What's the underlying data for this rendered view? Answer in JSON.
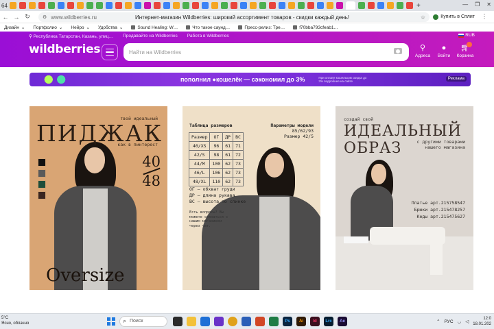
{
  "browser": {
    "tab_label": "64",
    "window_controls": [
      "—",
      "❐",
      "✕"
    ],
    "page_title": "Интернет-магазин Wildberries: широкий ассортимент товаров - скидки каждый день!",
    "url": "www.wildberries.ru",
    "buy_extension": "Купить в Сплит",
    "bookmarks": [
      {
        "label": "Дизайн",
        "icon": "folder-icon"
      },
      {
        "label": "Портфолио",
        "icon": "folder-icon"
      },
      {
        "label": "Нейро",
        "icon": "folder-icon"
      },
      {
        "label": "Удобства",
        "icon": "folder-icon"
      },
      {
        "label": "Sound Healing: W…",
        "icon": "page-icon"
      },
      {
        "label": "Что такое саунд…",
        "icon": "page-icon"
      },
      {
        "label": "Пресс-релиз: Тре…",
        "icon": "page-icon"
      },
      {
        "label": "f70bba793cfeab1…",
        "icon": "page-icon"
      }
    ]
  },
  "header": {
    "location": "Республика Татарстан, Казань, улиц…",
    "sell_link": "Продавайте на Wildberries",
    "work_link": "Работа в Wildberries",
    "currency": "RUB",
    "logo": "wildberries",
    "search_placeholder": "Найти на Wildberries",
    "actions": {
      "addresses": "Адреса",
      "login": "Войти",
      "cart": "Корзина"
    }
  },
  "banner": {
    "text": "пополнил ●кошелёк — сэкономил до 3%",
    "fine_print": "При оплате кошельком скидка до 3% подробнее на сайте",
    "ad_label": "Реклама"
  },
  "cards": {
    "card1": {
      "small_top": "твой идеальный",
      "title": "ПИДЖАК",
      "subtitle": "как в пинтерест",
      "size_top": "40",
      "size_bottom": "48",
      "swatches": [
        "#111111",
        "#5a5a5a",
        "#1d4d3a",
        "#3b2620"
      ],
      "bottom_word": "Oversize"
    },
    "card2": {
      "table_title": "Таблица размеров",
      "params_title": "Параметры модели",
      "params_line1": "85/62/93",
      "params_line2": "Размер 42/5",
      "table": [
        [
          "Размер",
          "ОГ",
          "ДР",
          "ВС"
        ],
        [
          "40/XS",
          "96",
          "61",
          "71"
        ],
        [
          "42/S",
          "98",
          "61",
          "72"
        ],
        [
          "44/M",
          "100",
          "62",
          "73"
        ],
        [
          "46/L",
          "106",
          "62",
          "73"
        ],
        [
          "48/XL",
          "110",
          "62",
          "73"
        ]
      ],
      "legend": [
        "ОГ – обхват груди",
        "ДР – длина рукава",
        "ВС – высота по спинке"
      ],
      "contact": "Есть вопросы? Вы можете связаться с нашим магазином через чат."
    },
    "card3": {
      "small_top": "создай свой",
      "title_line1": "ИДЕАЛЬНЫЙ",
      "title_line2": "ОБРАЗ",
      "subtitle_line1": "с другими товарами",
      "subtitle_line2": "нашего магазина",
      "articles": [
        "Платье арт.215758547",
        "Брюки арт.215478257",
        "Кеды арт.215475627"
      ]
    }
  },
  "taskbar": {
    "weather_temp": "5°C",
    "weather_desc": "Ясно, облачно",
    "search": "Поиск",
    "lang": "РУС",
    "time": "12:0",
    "date": "18.01.202",
    "apps": [
      "Ps",
      "Ai",
      "Id",
      "Lrc",
      "Ae"
    ]
  }
}
